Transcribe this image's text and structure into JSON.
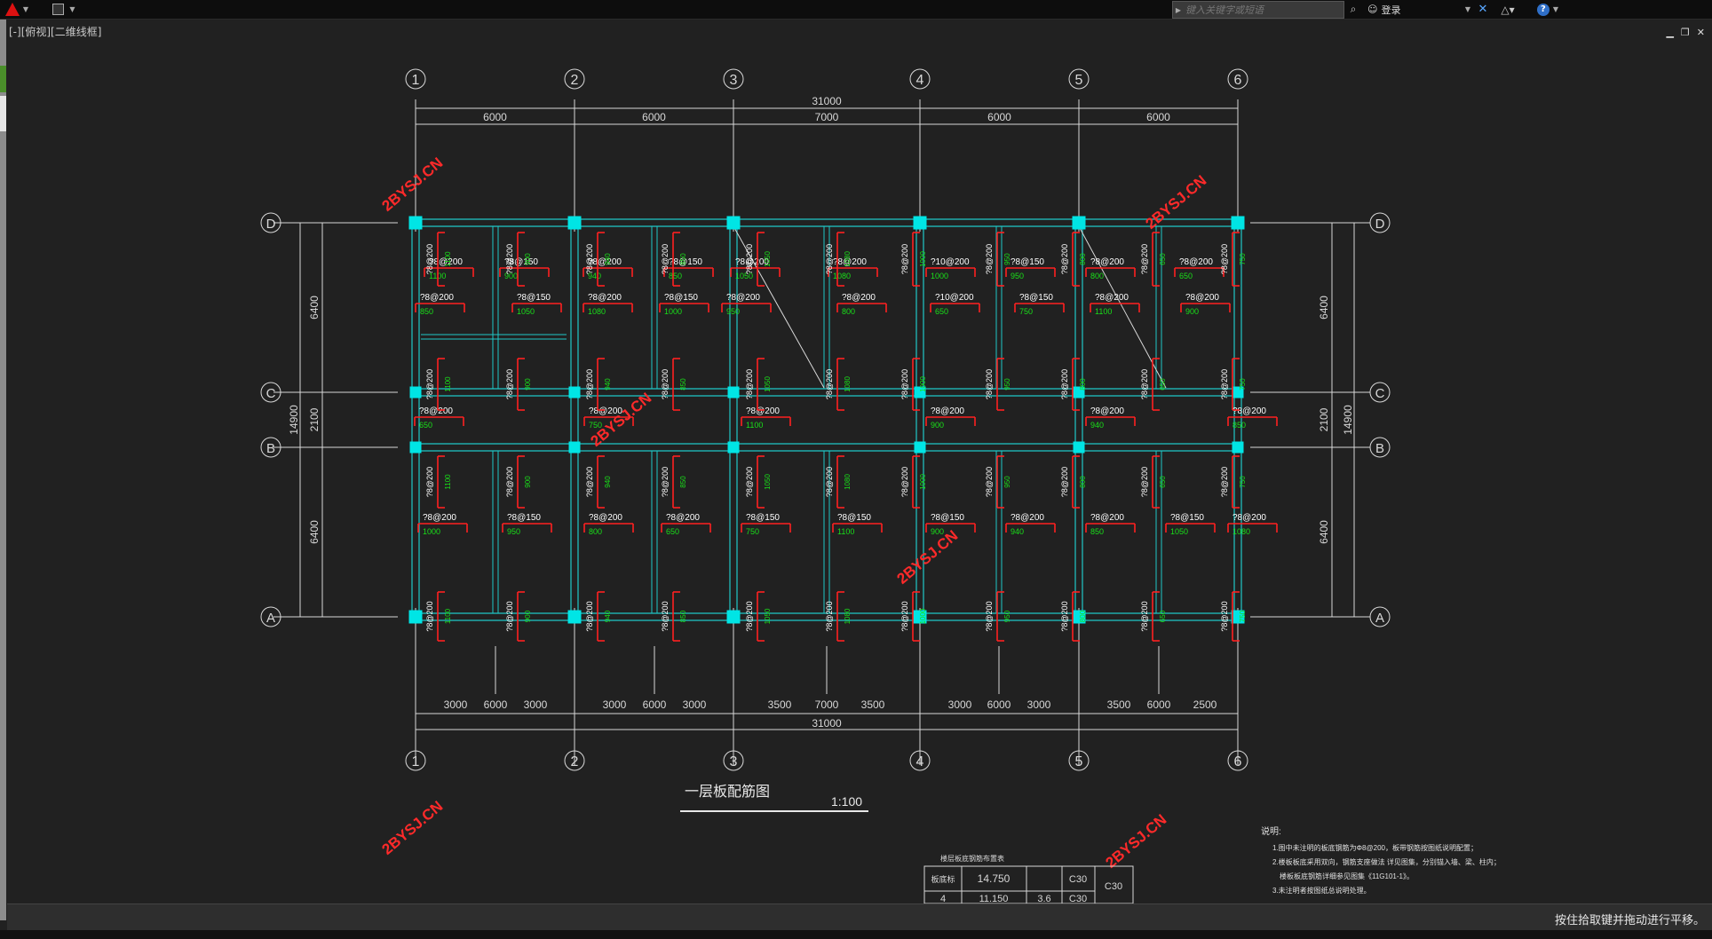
{
  "titlebar": {
    "search_placeholder": "键入关键字或短语",
    "login_label": "登录",
    "icons": [
      "autocad-logo",
      "save-icon",
      "binoculars-icon",
      "user-icon",
      "exchange-icon",
      "a360-icon",
      "help-icon"
    ]
  },
  "viewport": {
    "label": "[-][俯视][二维线框]"
  },
  "drawing": {
    "grid_columns": [
      "1",
      "2",
      "3",
      "4",
      "5",
      "6"
    ],
    "grid_rows": [
      "D",
      "C",
      "B",
      "A"
    ],
    "top_total": "31000",
    "top_spans": [
      "6000",
      "6000",
      "7000",
      "6000",
      "6000"
    ],
    "bottom_total": "31000",
    "bottom_spans": [
      "3000",
      "6000",
      "3000",
      "3000",
      "6000",
      "3000",
      "3500",
      "7000",
      "3500",
      "3000",
      "6000",
      "3000",
      "3500",
      "6000",
      "2500"
    ],
    "left_spans": [
      "6400",
      "2100",
      "6400"
    ],
    "left_total": "14900",
    "right_spans": [
      "6400",
      "2100",
      "6400"
    ],
    "right_total": "14900",
    "watermark": "2BYSJ.CN",
    "rebar_labels": [
      "?8@200",
      "?8@150",
      "?10@200"
    ],
    "rebar_lengths": [
      "1100",
      "900",
      "940",
      "850",
      "1050",
      "1080",
      "1000",
      "950",
      "800",
      "650",
      "750"
    ],
    "title": "一层板配筋图",
    "scale": "1:100",
    "table_title": "楼层板底钢筋布置表",
    "table": {
      "r1_label": "板底标",
      "r1_elev": "14.750",
      "r1_conc": "C30",
      "r2_label": "4",
      "r2_elev": "11.150",
      "r2_h": "3.6",
      "r2_conc": "C30",
      "merged": "C30"
    },
    "notes_title": "说明:",
    "notes": [
      "1.图中未注明的板底钢筋为Φ8@200，板带钢筋按图纸说明配置；",
      "2.楼板板底采用双向，钢筋支座做法 详见图集，分别锚入墙、梁、柱内；",
      "楼板板底钢筋详细参见图集《11G101-1》。",
      "3.未注明者按图纸总说明处理。"
    ],
    "colors": {
      "axis": "#d8d8d8",
      "beam": "#1fc8c8",
      "column": "#00e5e5",
      "rebar": "#ff2020",
      "rebar_text": "#ffffff",
      "length_text": "#19e019",
      "watermark": "#ff2a2a"
    }
  },
  "status": {
    "text": "按住拾取键并拖动进行平移。"
  }
}
